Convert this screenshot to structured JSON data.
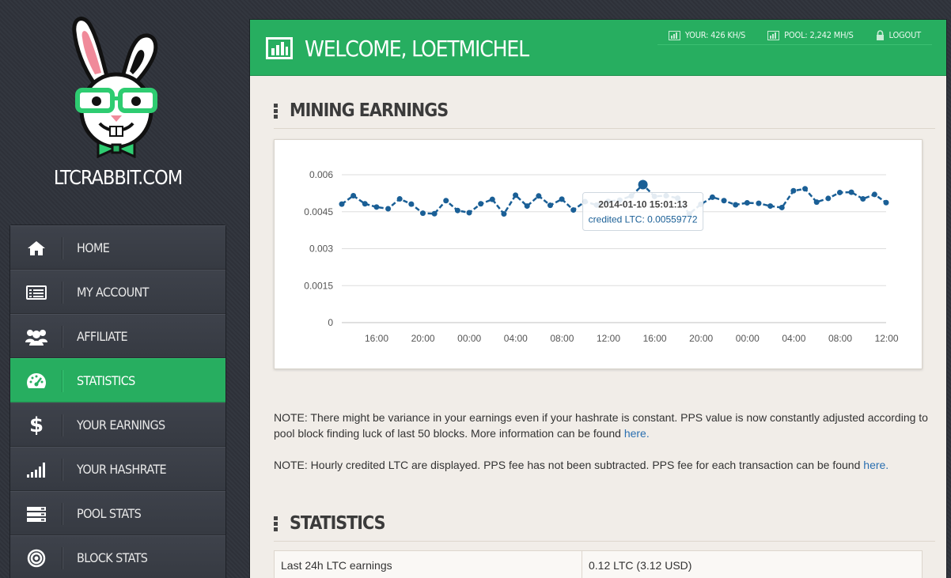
{
  "site": {
    "name": "LTCRABBIT.COM"
  },
  "nav": [
    {
      "label": "HOME",
      "icon": "home-icon",
      "active": false
    },
    {
      "label": "MY ACCOUNT",
      "icon": "account-card-icon",
      "active": false
    },
    {
      "label": "AFFILIATE",
      "icon": "users-group-icon",
      "active": false
    },
    {
      "label": "STATISTICS",
      "icon": "dashboard-gauge-icon",
      "active": true
    },
    {
      "label": "YOUR EARNINGS",
      "icon": "dollar-icon",
      "active": false
    },
    {
      "label": "YOUR HASHRATE",
      "icon": "signal-bars-icon",
      "active": false
    },
    {
      "label": "POOL STATS",
      "icon": "server-stack-icon",
      "active": false
    },
    {
      "label": "BLOCK STATS",
      "icon": "target-icon",
      "active": false
    }
  ],
  "header": {
    "title": "WELCOME, LOETMICHEL",
    "your_hashrate": "YOUR: 426 KH/S",
    "pool_hashrate": "POOL: 2,242 MH/S",
    "logout": "LOGOUT"
  },
  "mining": {
    "title": "MINING EARNINGS",
    "note1_text": "NOTE: There might be variance in your earnings even if your hashrate is constant. PPS value is now constantly adjusted according to pool block finding luck of last 50 blocks. More information can be found ",
    "note1_link": "here.",
    "note2_text": "NOTE: Hourly credited LTC are displayed. PPS fee has not been subtracted. PPS fee for each transaction can be found ",
    "note2_link": "here."
  },
  "statistics": {
    "title": "STATISTICS",
    "rows": [
      {
        "label": "Last 24h LTC earnings",
        "value": "0.12 LTC (3.12 USD)"
      }
    ]
  },
  "chart_data": {
    "type": "line",
    "yticks": [
      "0.006",
      "0.0045",
      "0.003",
      "0.0015",
      "0"
    ],
    "ylim": [
      0,
      0.006
    ],
    "xticks": [
      "16:00",
      "20:00",
      "00:00",
      "04:00",
      "08:00",
      "12:00",
      "16:00",
      "20:00",
      "00:00",
      "04:00",
      "08:00",
      "12:00"
    ],
    "series": [
      {
        "values": [
          0.00481,
          0.00515,
          0.00482,
          0.00469,
          0.00462,
          0.00502,
          0.00481,
          0.00444,
          0.00442,
          0.00495,
          0.00455,
          0.00446,
          0.00482,
          0.005,
          0.00441,
          0.00517,
          0.00473,
          0.00514,
          0.00476,
          0.00501,
          0.00457,
          0.00491,
          0.00477,
          0.00492,
          0.00497,
          0.00514,
          0.00559772,
          0.00512,
          0.00515,
          0.00505,
          0.00441,
          0.0048,
          0.00509,
          0.00495,
          0.00478,
          0.00486,
          0.00484,
          0.00473,
          0.00467,
          0.00535,
          0.00543,
          0.00489,
          0.00504,
          0.00528,
          0.00529,
          0.00502,
          0.0052,
          0.00487
        ]
      }
    ],
    "tooltip": {
      "date": "2014-01-10 15:01:13",
      "text": "credited LTC: 0.00559772",
      "index": 26
    },
    "line_color": "#1a5f96"
  }
}
